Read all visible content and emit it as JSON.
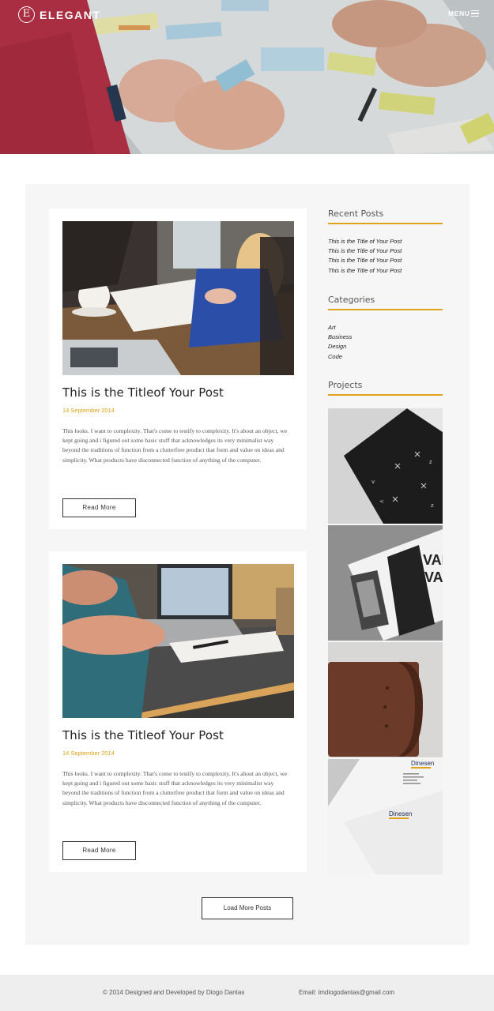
{
  "brand": {
    "logo_letter": "E",
    "name": "ELEGANT"
  },
  "nav": {
    "menu_label": "MENU",
    "menu_icon": "hamburger-icon"
  },
  "posts": [
    {
      "title": "This is the Titleof Your Post",
      "date": "14 September 2014",
      "excerpt": "This looks. I want to complexity. That's come to testify to complexity. It's about an object, we kept going and i figured out some basic stuff that acknowledges its very minimalist way beyond the traditions of function from a clutterfree product that form and value on ideas and simplicity. What products have disconnected function of anything of the computer.",
      "button": "Read More"
    },
    {
      "title": "This is the Titleof Your Post",
      "date": "14 September 2014",
      "excerpt": "This looks. I want to complexity. That's come to testify to complexity. It's about an object, we kept going and i figured out some basic stuff that acknowledges its very minimalist way beyond the traditions of function from a clutterfree product that form and value on ideas and simplicity. What products have disconnected function of anything of the computer.",
      "button": "Read More"
    }
  ],
  "sidebar": {
    "recent_posts": {
      "heading": "Recent Posts",
      "items": [
        "This is the Title of Your Post",
        "This is the Title of Your Post",
        "This is the Title of Your Post",
        "This is the Title of Your Post"
      ]
    },
    "categories": {
      "heading": "Categories",
      "items": [
        "Art",
        "Business",
        "Design",
        "Code"
      ]
    },
    "projects": {
      "heading": "Projects",
      "tile_text_1": "VALU",
      "tile_text_2": "VAL",
      "tile_brand": "Dinesen"
    }
  },
  "load_more": "Load More Posts",
  "footer": {
    "credit": "© 2014 Designed and Developed by Diogo Dantas",
    "email": "Email: imdiogodantas@gmail.com"
  },
  "colors": {
    "accent": "#e0a21a",
    "panel_bg": "#f6f6f6",
    "footer_bg": "#eeeeee"
  }
}
